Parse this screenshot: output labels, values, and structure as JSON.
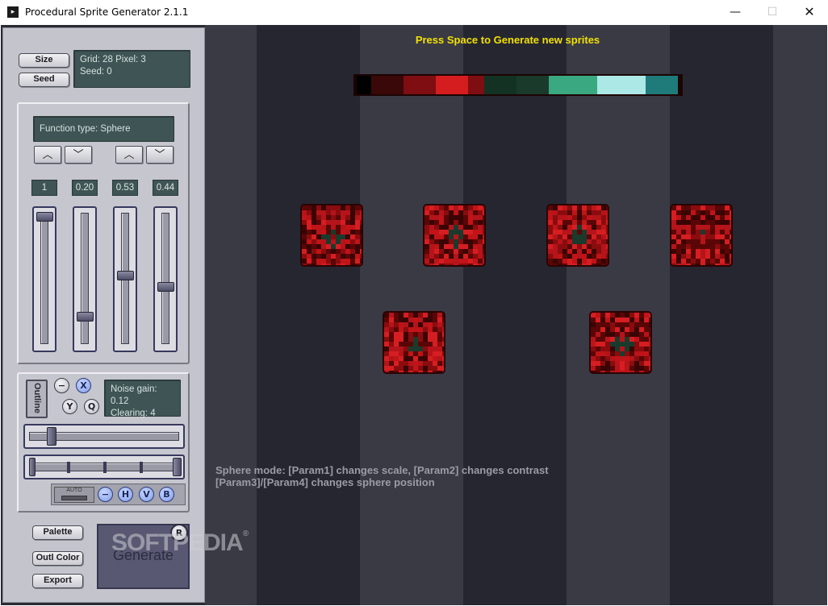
{
  "window": {
    "title": "Procedural Sprite Generator 2.1.1",
    "min_glyph": "—",
    "max_glyph": "☐",
    "close_glyph": "✕"
  },
  "size_seed": {
    "size_label": "Size",
    "seed_label": "Seed",
    "grid_line": "Grid: 28 Pixel: 3",
    "seed_line": "Seed: 0"
  },
  "function": {
    "type_line": "Function type: Sphere",
    "arrow_up": "︿",
    "arrow_down": "﹀",
    "param_values": [
      "1",
      "0.20",
      "0.53",
      "0.44"
    ],
    "param_levels": [
      1.0,
      0.2,
      0.53,
      0.44
    ]
  },
  "noise": {
    "outline_label": "Outline",
    "minus": "−",
    "x": "X",
    "y": "Y",
    "q": "Q",
    "gain_line": "Noise gain: 0.12",
    "clearing_line": "Clearing: 4",
    "noise_level": 0.12
  },
  "auto_row": {
    "auto_label": "AUTO",
    "minus": "−",
    "h": "H",
    "v": "V",
    "b": "B"
  },
  "bottom": {
    "palette_label": "Palette",
    "outl_color_label": "Outl Color",
    "export_label": "Export",
    "generate_label": "Generate",
    "r_label": "R"
  },
  "canvas": {
    "top_hint": "Press Space to Generate new sprites",
    "mode_hint_1": "Sphere mode: [Param1] changes scale, [Param2] changes contrast",
    "mode_hint_2": "[Param3]/[Param4] changes sphere position",
    "palette_colors": [
      "#000000",
      "#3a0808",
      "#7e0e12",
      "#d51c1e",
      "#7e0e12",
      "#143224",
      "#1a3a2c",
      "#3aa880",
      "#abe8e6",
      "#1f7a7a"
    ],
    "stripe_colors": [
      "#262631",
      "#3a3a45"
    ],
    "watermark": "SOFTPEDIA",
    "watermark_reg": "®"
  }
}
